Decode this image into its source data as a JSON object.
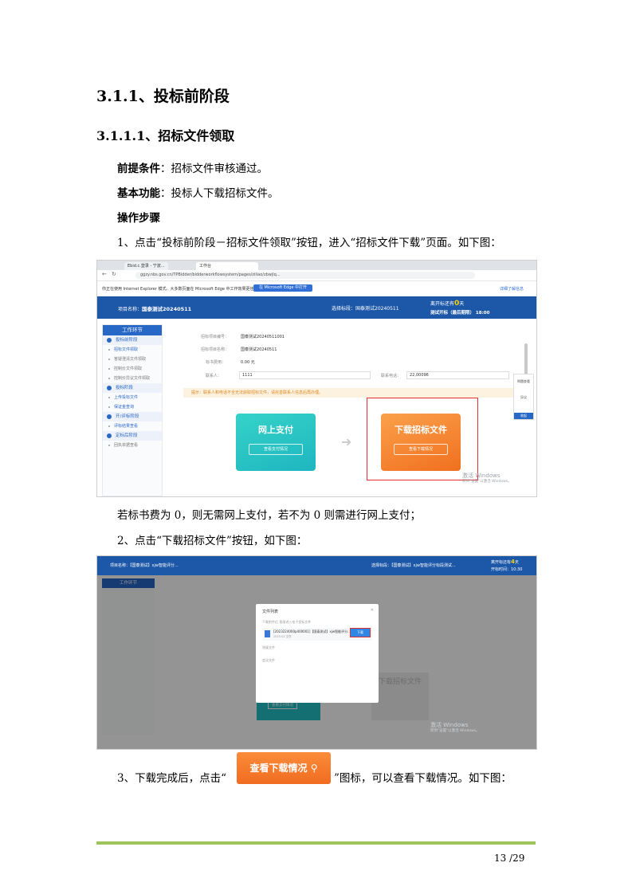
{
  "heading1": "3.1.1、投标前阶段",
  "heading2": "3.1.1.1、招标文件领取",
  "prereq": {
    "label": "前提条件",
    "text": "：招标文件审核通过。"
  },
  "func": {
    "label": "基本功能",
    "text": "：投标人下载招标文件。"
  },
  "steps_label": "操作步骤",
  "step1": "1、点击“投标前阶段－招标文件领取”按钮，进入“招标文件下载”页面。如下图：",
  "para_fee": "若标书费为 0，则无需网上支付，若不为 0 则需进行网上支付；",
  "step2": "2、点击“下载招标文件”按钮，如下图：",
  "step3_pre": "3、下载完成后，点击“",
  "step3_post": "”图标，可以查看下载情况。如下图：",
  "inline_button": "查看下载情况",
  "page_number": "13 /29",
  "shot1": {
    "tab1": "Ebid.c.登录 - 宁波...",
    "tab2": "工作台",
    "address": "ggzy.nbs.gov.cn/TPBidder/bidderworkflowsystem/pages/ziliao/zbwjlq...",
    "notice": "你正在使用 Internet Explorer 模式。大多数页面在 Microsoft Edge 中工作效果更佳。",
    "edge_button": "在 Microsoft Edge 中打开",
    "notice_right": "详细了解信息",
    "project_label": "项目名称：",
    "project_name": "国泰测试20240511",
    "section_label": "选择标段：",
    "section_name": "国泰测试20240511",
    "dist_pre": "离开标还有",
    "dist_num": "0",
    "dist_post": "天",
    "open_time": "测试开标（最后期限） 18:00",
    "sidebar_title": "工作环节",
    "sidebar": [
      {
        "type": "sec",
        "label": "投标前阶段"
      },
      {
        "type": "it",
        "label": "招标文件领取",
        "on": true
      },
      {
        "type": "it",
        "label": "答疑澄清文件领取"
      },
      {
        "type": "it",
        "label": "控制价文件领取"
      },
      {
        "type": "it",
        "label": "控制价异议文件领取"
      },
      {
        "type": "sec",
        "label": "投标阶段"
      },
      {
        "type": "it",
        "label": "上传投标文件",
        "on": true
      },
      {
        "type": "it",
        "label": "保证金查询",
        "on": true
      },
      {
        "type": "sec",
        "label": "开/评标阶段"
      },
      {
        "type": "it",
        "label": "评标结果查看",
        "on": true
      },
      {
        "type": "sec",
        "label": "定标后阶段"
      },
      {
        "type": "it",
        "label": "回执单据查看"
      }
    ],
    "f1_label": "招标项目编号：",
    "f1_value": "国泰测试20240511001",
    "f2_label": "招标项目名称：",
    "f2_value": "国泰测试20240511",
    "f3_label": "标书费用：",
    "f3_value": "0.00 元",
    "f4_label": "联系人：",
    "f4_value": "1111",
    "f5_label": "联系电话：",
    "f5_value": "22,00096",
    "warning": "提示：联系人和电话不全无法获取招标文件，请完善联系人信息后再办理。",
    "card1_title": "网上支付",
    "card1_btn": "查看支付情况",
    "card2_title": "下载招标文件",
    "card2_btn": "查看下载情况",
    "tool1": "問題查看",
    "tool2": "异议",
    "tool3": "收起",
    "wm_title": "激活 Windows",
    "wm_sub": "转到\"设置\"以激活 Windows。"
  },
  "shot2": {
    "project": "项目名称：【国泰测试】xjw智能评分...",
    "section": "选择标段：【国泰测试】xjw智能评分标段测试...",
    "dist_pre": "离开标还有",
    "dist_num": "4",
    "dist_post": "天",
    "open_time": "开标时间：10:30",
    "dialog_title": "文件列表",
    "dialog_hint": "下载附件后 直接进入电子投标文件",
    "file_name": "[2023224000p400001]【国泰测试】xjw智能评分...",
    "file_size": "2023-02 文件",
    "download_btn": "下载",
    "sub1": "答疑文件",
    "sub2": "会议文件",
    "wm_title": "激活 Windows",
    "wm_sub": "转到\"设置\"以激活 Windows。",
    "bg_card": "下载招标文件",
    "bg_btn": "查看支付情况"
  }
}
